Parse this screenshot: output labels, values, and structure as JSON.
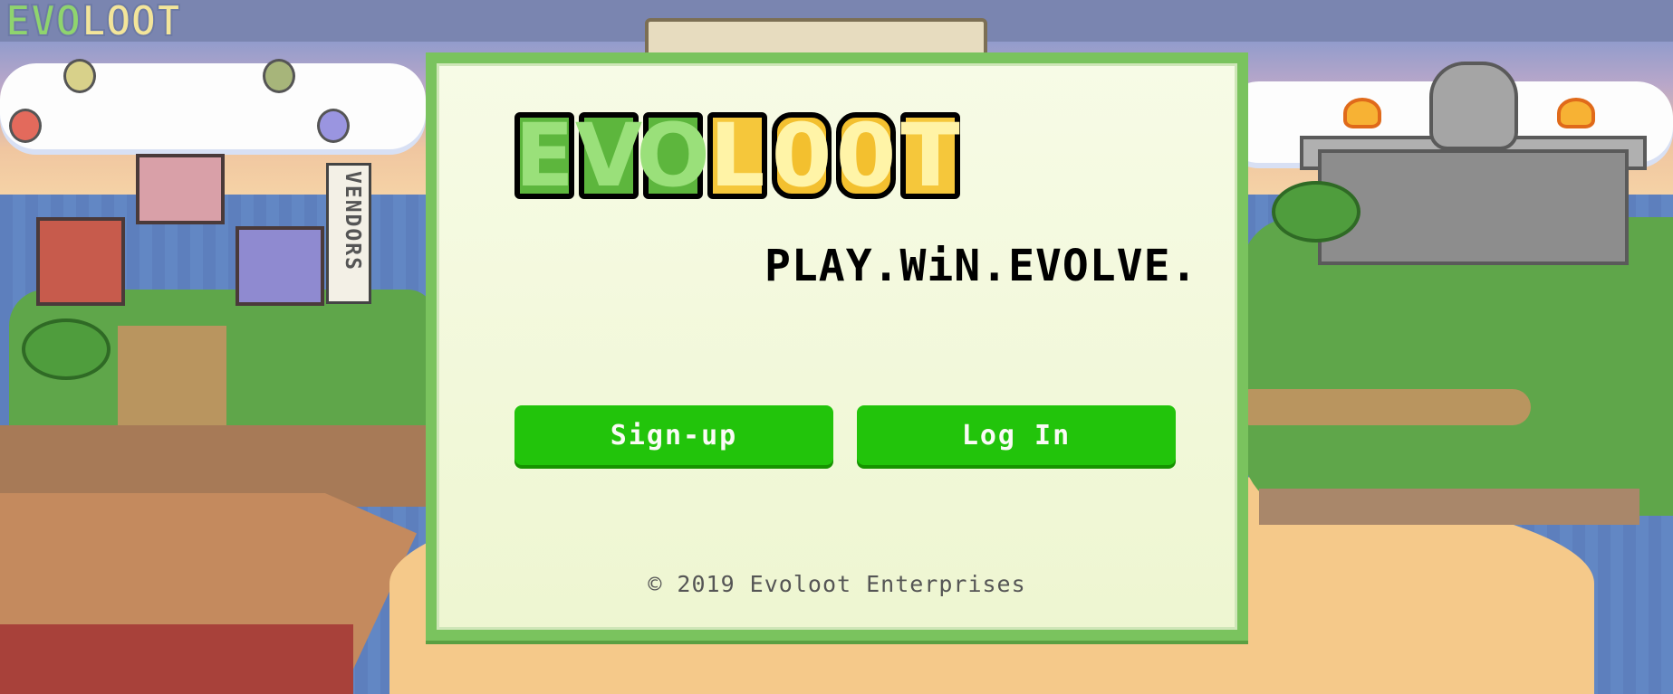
{
  "background": {
    "logo_letters": [
      "E",
      "V",
      "O",
      "L",
      "O",
      "O",
      "T"
    ],
    "vendor_sign": "VENDORS"
  },
  "modal": {
    "logo": {
      "letters": [
        "E",
        "V",
        "O",
        "L",
        "0",
        "0",
        "T"
      ]
    },
    "tagline": "PLAY.WiN.EVOLVE.",
    "buttons": {
      "signup_label": "Sign-up",
      "login_label": "Log In"
    },
    "copyright": "© 2019 Evoloot Enterprises"
  },
  "colors": {
    "modal_border": "#7ac35e",
    "button": "#22c40b",
    "logo_green": "#5db63d",
    "logo_gold": "#f5c73b"
  }
}
